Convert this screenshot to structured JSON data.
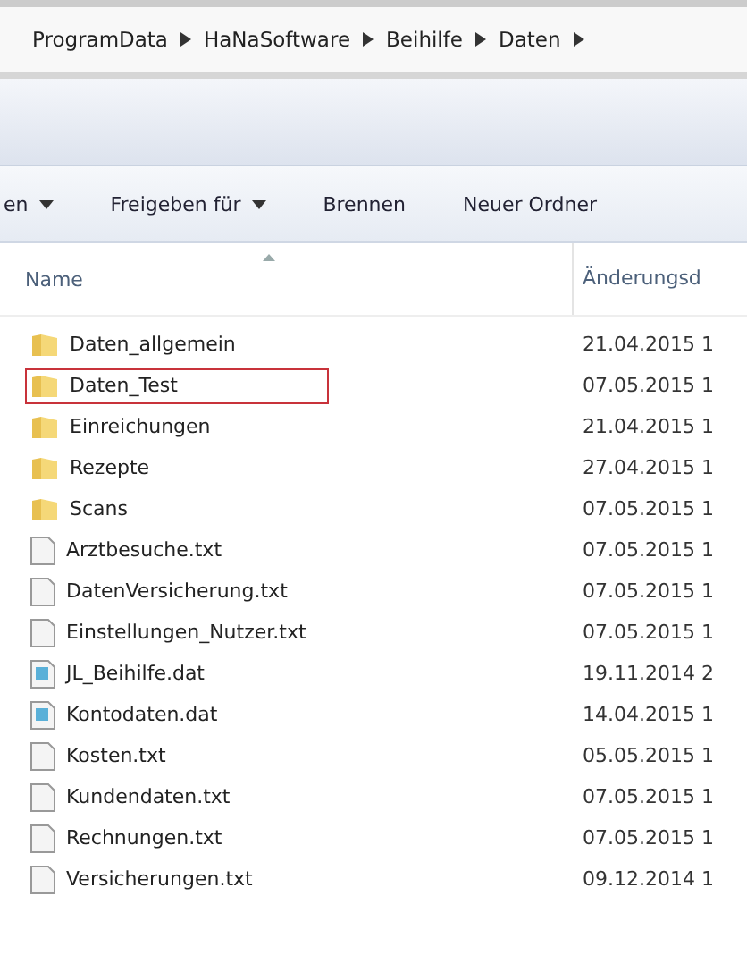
{
  "breadcrumb": [
    "ProgramData",
    "HaNaSoftware",
    "Beihilfe",
    "Daten"
  ],
  "toolbar": [
    {
      "label": "en",
      "dropdown": true
    },
    {
      "label": "Freigeben für",
      "dropdown": true
    },
    {
      "label": "Brennen",
      "dropdown": false
    },
    {
      "label": "Neuer Ordner",
      "dropdown": false
    }
  ],
  "columns": [
    "Name",
    "Änderungsd"
  ],
  "files": [
    {
      "name": "Daten_allgemein",
      "kind": "folder",
      "date": "21.04.2015 1",
      "highlighted": false
    },
    {
      "name": "Daten_Test",
      "kind": "folder",
      "date": "07.05.2015 1",
      "highlighted": true
    },
    {
      "name": "Einreichungen",
      "kind": "folder",
      "date": "21.04.2015 1",
      "highlighted": false
    },
    {
      "name": "Rezepte",
      "kind": "folder",
      "date": "27.04.2015 1",
      "highlighted": false
    },
    {
      "name": "Scans",
      "kind": "folder",
      "date": "07.05.2015 1",
      "highlighted": false
    },
    {
      "name": "Arztbesuche.txt",
      "kind": "text",
      "date": "07.05.2015 1",
      "highlighted": false
    },
    {
      "name": "DatenVersicherung.txt",
      "kind": "text",
      "date": "07.05.2015 1",
      "highlighted": false
    },
    {
      "name": "Einstellungen_Nutzer.txt",
      "kind": "text",
      "date": "07.05.2015 1",
      "highlighted": false
    },
    {
      "name": "JL_Beihilfe.dat",
      "kind": "data",
      "date": "19.11.2014 2",
      "highlighted": false
    },
    {
      "name": "Kontodaten.dat",
      "kind": "data",
      "date": "14.04.2015 1",
      "highlighted": false
    },
    {
      "name": "Kosten.txt",
      "kind": "text",
      "date": "05.05.2015 1",
      "highlighted": false
    },
    {
      "name": "Kundendaten.txt",
      "kind": "text",
      "date": "07.05.2015 1",
      "highlighted": false
    },
    {
      "name": "Rechnungen.txt",
      "kind": "text",
      "date": "07.05.2015 1",
      "highlighted": false
    },
    {
      "name": "Versicherungen.txt",
      "kind": "text",
      "date": "09.12.2014 1",
      "highlighted": false
    }
  ]
}
